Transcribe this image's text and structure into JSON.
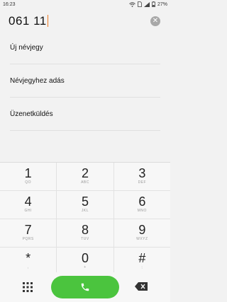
{
  "status_bar": {
    "time": "16:23",
    "battery": "27%"
  },
  "dialer": {
    "number": "061 11"
  },
  "actions": [
    {
      "label": "Új névjegy"
    },
    {
      "label": "Névjegyhez adás"
    },
    {
      "label": "Üzenetküldés"
    }
  ],
  "keypad": [
    [
      {
        "digit": "1",
        "letters": "QO"
      },
      {
        "digit": "2",
        "letters": "ABC"
      },
      {
        "digit": "3",
        "letters": "DEF"
      }
    ],
    [
      {
        "digit": "4",
        "letters": "GHI"
      },
      {
        "digit": "5",
        "letters": "JKL"
      },
      {
        "digit": "6",
        "letters": "MNO"
      }
    ],
    [
      {
        "digit": "7",
        "letters": "PQRS"
      },
      {
        "digit": "8",
        "letters": "TUV"
      },
      {
        "digit": "9",
        "letters": "WXYZ"
      }
    ],
    [
      {
        "digit": "*",
        "letters": ","
      },
      {
        "digit": "0",
        "letters": "+"
      },
      {
        "digit": "#",
        "letters": ";"
      }
    ]
  ],
  "colors": {
    "accent": "#f07a22",
    "call": "#4bc43e"
  },
  "icons": {
    "wifi": "wifi-icon",
    "signal": "signal-icon",
    "sim": "sim-icon",
    "battery": "battery-icon",
    "clear": "clear-icon",
    "dialpad": "dialpad-icon",
    "call": "phone-icon",
    "backspace": "backspace-icon"
  }
}
